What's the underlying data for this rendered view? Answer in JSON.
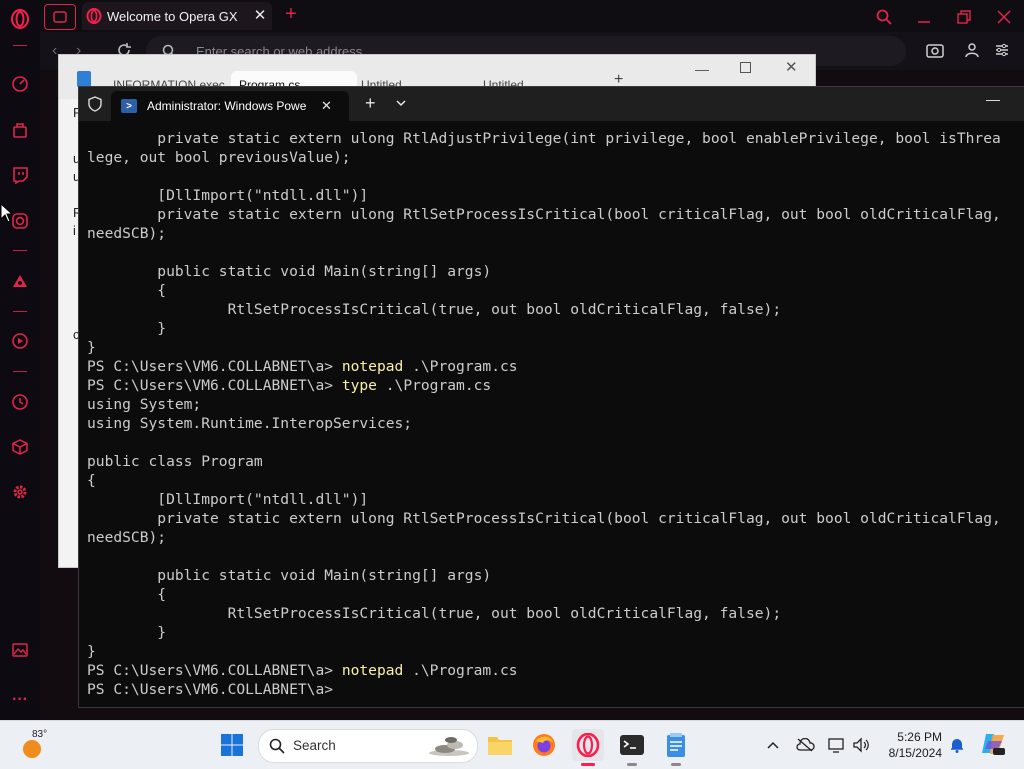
{
  "browser": {
    "tab_title": "Welcome to Opera GX",
    "address_placeholder": "Enter search or web address"
  },
  "notepad": {
    "tabs": [
      "INFORMATION.exec",
      "Program.cs",
      "Untitled",
      "Untitled"
    ],
    "side_letters": [
      "P",
      "u",
      "u",
      "P",
      "i",
      "c"
    ]
  },
  "terminal": {
    "tab_title": "Administrator: Windows Powe",
    "lines": [
      {
        "text": "        private static extern ulong RtlAdjustPrivilege(int privilege, bool enablePrivilege, bool isThrea"
      },
      {
        "text": "lege, out bool previousValue);"
      },
      {
        "text": ""
      },
      {
        "text": "        [DllImport(\"ntdll.dll\")]"
      },
      {
        "text": "        private static extern ulong RtlSetProcessIsCritical(bool criticalFlag, out bool oldCriticalFlag,"
      },
      {
        "text": "needSCB);"
      },
      {
        "text": ""
      },
      {
        "text": "        public static void Main(string[] args)"
      },
      {
        "text": "        {"
      },
      {
        "text": "                RtlSetProcessIsCritical(true, out bool oldCriticalFlag, false);"
      },
      {
        "text": "        }"
      },
      {
        "text": "}"
      },
      {
        "prompt": "PS C:\\Users\\VM6.COLLABNET\\a> ",
        "cmd": "notepad",
        "args": " .\\Program.cs"
      },
      {
        "prompt": "PS C:\\Users\\VM6.COLLABNET\\a> ",
        "cmd": "type",
        "args": " .\\Program.cs"
      },
      {
        "text": "using System;"
      },
      {
        "text": "using System.Runtime.InteropServices;"
      },
      {
        "text": ""
      },
      {
        "text": "public class Program"
      },
      {
        "text": "{"
      },
      {
        "text": "        [DllImport(\"ntdll.dll\")]"
      },
      {
        "text": "        private static extern ulong RtlSetProcessIsCritical(bool criticalFlag, out bool oldCriticalFlag,"
      },
      {
        "text": "needSCB);"
      },
      {
        "text": ""
      },
      {
        "text": "        public static void Main(string[] args)"
      },
      {
        "text": "        {"
      },
      {
        "text": "                RtlSetProcessIsCritical(true, out bool oldCriticalFlag, false);"
      },
      {
        "text": "        }"
      },
      {
        "text": "}"
      },
      {
        "prompt": "PS C:\\Users\\VM6.COLLABNET\\a> ",
        "cmd": "notepad",
        "args": " .\\Program.cs"
      },
      {
        "prompt": "PS C:\\Users\\VM6.COLLABNET\\a> ",
        "cmd": "",
        "args": ""
      }
    ]
  },
  "taskbar": {
    "weather_temp": "83°",
    "search_label": "Search",
    "time": "5:26 PM",
    "date": "8/15/2024"
  },
  "colors": {
    "gx_accent": "#fa1e4e",
    "term_bg": "#0c0c0c",
    "term_text": "#cccccc",
    "term_cmd": "#f9f1a5"
  }
}
